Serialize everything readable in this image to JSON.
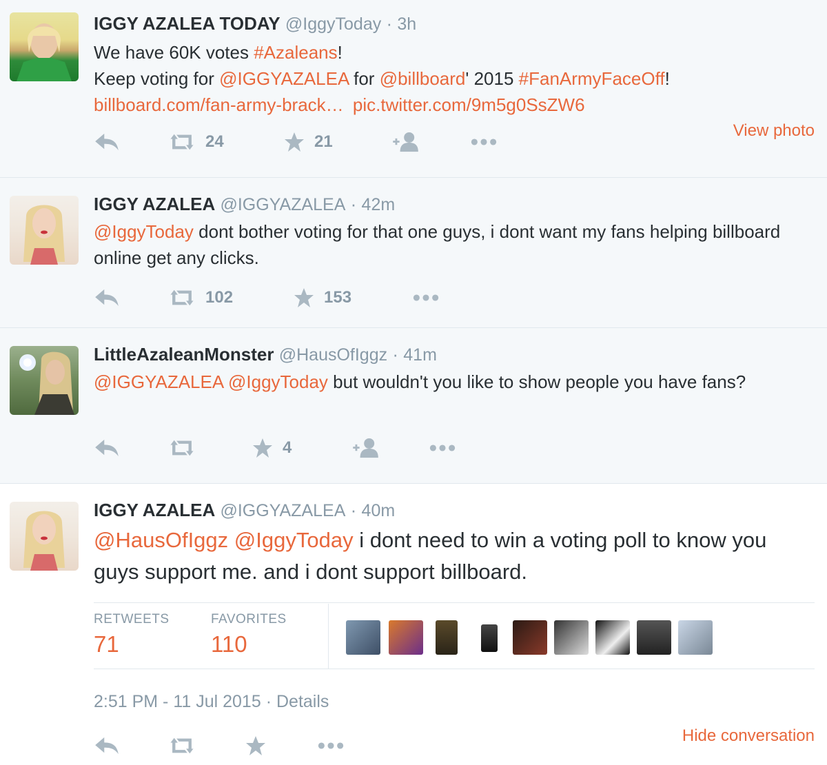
{
  "tweets": [
    {
      "name": "IGGY AZALEA TODAY",
      "handle": "@IggyToday",
      "time": "3h",
      "line1_pre": "We have 60K votes ",
      "line1_tag": "#Azaleans",
      "line1_post": "!",
      "line2_pre": "Keep voting for ",
      "line2_m1": "@IGGYAZALEA",
      "line2_mid": " for ",
      "line2_m2": "@billboard",
      "line2_mid2": "' 2015 ",
      "line2_tag": "#FanArmyFaceOff",
      "line2_post": "!",
      "line3_link1": "billboard.com/fan-army-brack…",
      "line3_link2": "pic.twitter.com/9m5g0SsZW6",
      "retweets": "24",
      "favorites": "21",
      "view_photo": "View photo"
    },
    {
      "name": "IGGY AZALEA",
      "handle": "@IGGYAZALEA",
      "time": "42m",
      "mention": "@IggyToday",
      "text_rest": " dont bother voting for that one guys, i dont want my fans helping billboard online get any clicks.",
      "retweets": "102",
      "favorites": "153"
    },
    {
      "name": "LittleAzaleanMonster",
      "handle": "@HausOfIggz",
      "time": "41m",
      "mention1": "@IGGYAZALEA",
      "mention2": "@IggyToday",
      "text_rest": " but wouldn't you like to show people you have fans?",
      "favorites": "4"
    },
    {
      "name": "IGGY AZALEA",
      "handle": "@IGGYAZALEA",
      "time": "40m",
      "mention1": "@HausOfIggz",
      "mention2": "@IggyToday",
      "text_rest": " i dont need to win a voting poll to know you guys support me. and i dont support billboard.",
      "retweets_label": "RETWEETS",
      "retweets": "71",
      "favorites_label": "FAVORITES",
      "favorites": "110",
      "datetime": "2:51 PM - 11 Jul 2015",
      "details": "Details",
      "hide": "Hide conversation"
    }
  ],
  "colors": {
    "accent": "#e8683c",
    "muted": "#8899a6",
    "icon": "#aab8c2"
  }
}
